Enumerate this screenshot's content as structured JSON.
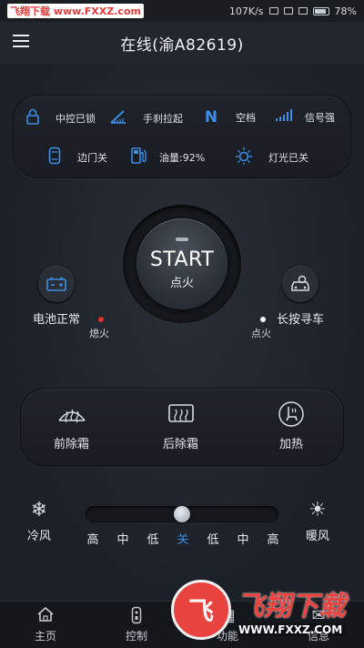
{
  "statusbar": {
    "watermark": "飞翔下载 www.FXXZ.com",
    "net_speed": "107K/s",
    "battery": "78%"
  },
  "header": {
    "title": "在线(渝A82619)"
  },
  "status_panel": {
    "row1": [
      {
        "icon": "lock-icon",
        "label": "中控已锁"
      },
      {
        "icon": "handbrake-icon",
        "label": "手刹拉起"
      },
      {
        "icon": "gear-n-icon",
        "glyph": "N",
        "label": "空档"
      },
      {
        "icon": "signal-icon",
        "label": "信号强"
      }
    ],
    "row2": [
      {
        "icon": "door-icon",
        "label": "边门关"
      },
      {
        "icon": "fuel-icon",
        "label": "油量:92%"
      },
      {
        "icon": "light-icon",
        "label": "灯光已关"
      }
    ]
  },
  "start": {
    "label": "START",
    "sub": "点火"
  },
  "battery_ctrl": {
    "label": "电池正常",
    "status": "熄火",
    "status_color": "#e0302b"
  },
  "find_car": {
    "label": "长按寻车",
    "status": "点火",
    "status_color": "#ffffff"
  },
  "defrost": [
    {
      "icon": "front-defrost-icon",
      "label": "前除霜"
    },
    {
      "icon": "rear-defrost-icon",
      "label": "后除霜"
    },
    {
      "icon": "seat-heat-icon",
      "label": "加热"
    }
  ],
  "climate": {
    "cold_label": "冷风",
    "warm_label": "暖风",
    "levels": [
      "高",
      "中",
      "低",
      "关",
      "低",
      "中",
      "高"
    ],
    "active_index": 3,
    "position_fraction": 0.5
  },
  "tabs": [
    {
      "icon": "home-icon",
      "label": "主页"
    },
    {
      "icon": "remote-icon",
      "label": "控制"
    },
    {
      "icon": "function-icon",
      "label": "功能"
    },
    {
      "icon": "info-icon",
      "label": "信息"
    }
  ],
  "overlay_watermark": {
    "logo_text": "飞",
    "brand": "飞翔下载",
    "url": "WWW.FXXZ.COM"
  },
  "colors": {
    "accent": "#3a8fe8",
    "background": "#1d2129"
  }
}
